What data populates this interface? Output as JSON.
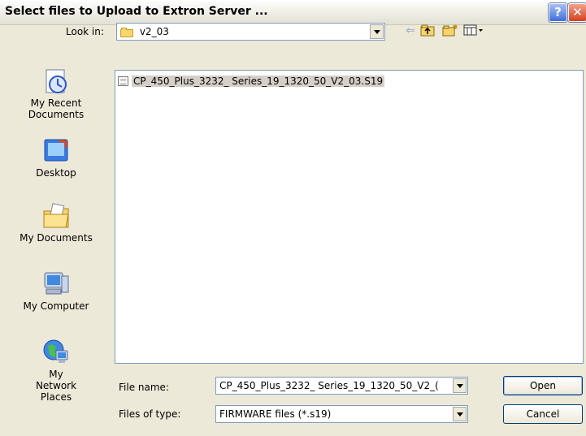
{
  "window": {
    "title": "Select files to Upload to Extron Server ...",
    "help_label": "?",
    "close_label": "✕"
  },
  "look_in": {
    "label": "Look in:",
    "value": "v2_03"
  },
  "toolbar": {
    "back_icon": "back-arrow-icon",
    "up_icon": "up-folder-icon",
    "new_folder_icon": "new-folder-icon",
    "views_icon": "views-menu-icon"
  },
  "places": [
    {
      "label": "My Recent Documents",
      "icon": "recent-documents-icon"
    },
    {
      "label": "Desktop",
      "icon": "desktop-icon"
    },
    {
      "label": "My Documents",
      "icon": "my-documents-icon"
    },
    {
      "label": "My Computer",
      "icon": "my-computer-icon"
    },
    {
      "label": "My Network Places",
      "icon": "network-places-icon"
    }
  ],
  "files": [
    {
      "name": "CP_450_Plus_3232_ Series_19_1320_50_V2_03.S19",
      "selected": true
    }
  ],
  "file_name": {
    "label": "File name:",
    "value": "CP_450_Plus_3232_ Series_19_1320_50_V2_("
  },
  "file_type": {
    "label": "Files of type:",
    "value": "FIRMWARE files (*.s19)"
  },
  "buttons": {
    "open": "Open",
    "cancel": "Cancel"
  }
}
